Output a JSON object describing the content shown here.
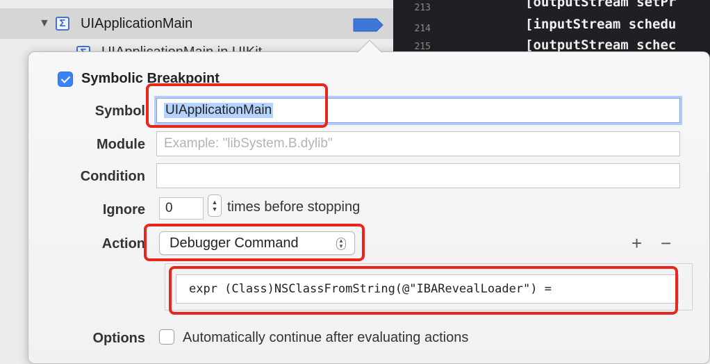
{
  "navigator": {
    "rows": [
      {
        "label": "UIApplicationMain",
        "icon": "sigma-icon",
        "selected": true
      },
      {
        "label": "UIApplicationMain in UIKit",
        "icon": "sigma-icon",
        "selected": false
      }
    ]
  },
  "editor": {
    "lines": [
      {
        "number": "213",
        "code": "[outputStream setPr"
      },
      {
        "number": "214",
        "code": "[inputStream schedu"
      },
      {
        "number": "215",
        "code": "[outputStream schec"
      }
    ]
  },
  "breakpoint": {
    "title": "Symbolic Breakpoint",
    "enabled": true,
    "symbol_label": "Symbol",
    "symbol_value": "UIApplicationMain",
    "module_label": "Module",
    "module_placeholder": "Example: \"libSystem.B.dylib\"",
    "condition_label": "Condition",
    "condition_value": "",
    "ignore_label": "Ignore",
    "ignore_value": "0",
    "ignore_suffix": "times before stopping",
    "action_label": "Action",
    "action_value": "Debugger Command",
    "add_label": "+",
    "remove_label": "−",
    "command_value": "expr (Class)NSClassFromString(@\"IBARevealLoader\") =",
    "options_label": "Options",
    "options_text": "Automatically continue after evaluating actions",
    "options_checked": false
  },
  "colors": {
    "annotation": "#e8261c",
    "accent": "#3a82f7",
    "editor_bg": "#1f2023"
  }
}
